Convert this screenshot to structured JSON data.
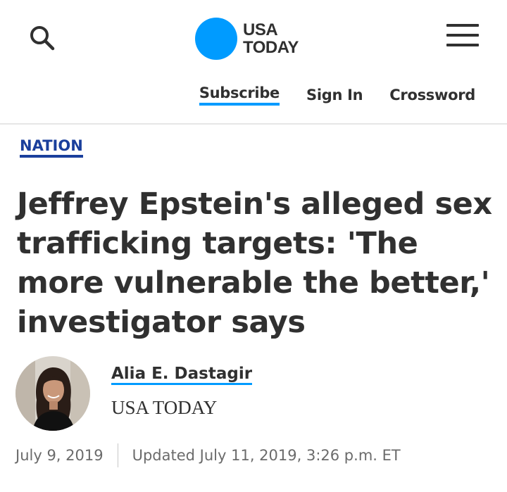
{
  "header": {
    "logo": {
      "text": "USA\nTODAY",
      "circle_color": "#009bff"
    },
    "nav": {
      "subscribe_label": "Subscribe",
      "signin_label": "Sign In",
      "crossword_label": "Crossword"
    },
    "icons": {
      "search": "search-icon",
      "menu": "hamburger-menu-icon"
    }
  },
  "article": {
    "section": "NATION",
    "section_color": "#1a3f9c",
    "headline": "Jeffrey Epstein's alleged sex trafficking targets: 'The more vulnerable the better,' investigator says",
    "author": {
      "name": "Alia E. Dastagir",
      "organization": "USA TODAY"
    },
    "published": "July 9, 2019",
    "updated": "Updated July 11, 2019, 3:26 p.m. ET"
  },
  "colors": {
    "accent": "#009bff",
    "text": "#303030",
    "muted": "#6b6b6b"
  }
}
